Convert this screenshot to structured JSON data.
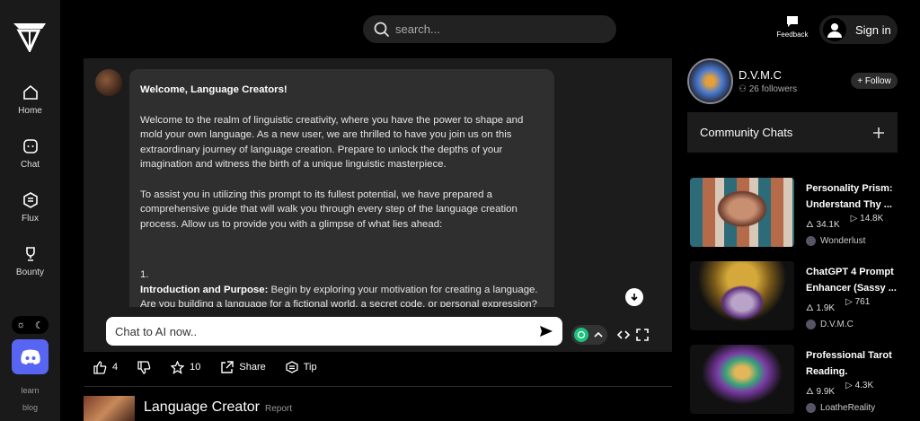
{
  "sidebar": {
    "items": [
      {
        "label": "Home",
        "icon": "home-icon"
      },
      {
        "label": "Chat",
        "icon": "chat-icon"
      },
      {
        "label": "Flux",
        "icon": "flux-icon"
      },
      {
        "label": "Bounty",
        "icon": "trophy-icon"
      }
    ],
    "learn": "learn",
    "blog": "blog"
  },
  "topbar": {
    "search_placeholder": "search...",
    "feedback_label": "Feedback",
    "signin_label": "Sign in"
  },
  "chat": {
    "heading": "Welcome, Language Creators!",
    "para1": "Welcome to the realm of linguistic creativity, where you have the power to shape and mold your own language. As a new user, we are thrilled to have you join us on this extraordinary journey of language creation. Prepare to unlock the depths of your imagination and witness the birth of a unique linguistic masterpiece.",
    "para2": "To assist you in utilizing this prompt to its fullest potential, we have prepared a comprehensive guide that will walk you through every step of the language creation process. Allow us to provide you with a glimpse of what lies ahead:",
    "list_number": "1.",
    "intro_bold": "Introduction and Purpose:",
    "intro_text": " Begin by exploring your motivation for creating a language. Are you building a language for a fictional world, a secret code, or personal expression?",
    "input_placeholder": "Chat to AI now.."
  },
  "actions": {
    "likes": "4",
    "favorites": "10",
    "share": "Share",
    "tip": "Tip"
  },
  "next_prompt": {
    "title": "Language Creator",
    "report": "Report"
  },
  "creator": {
    "name": "D.V.M.C",
    "followers": "26 followers",
    "follow_label": "+ Follow"
  },
  "community": {
    "title": "Community Chats"
  },
  "cards": [
    {
      "title": "Personality Prism: Understand Thy ...",
      "views": "34.1K",
      "plays": "14.8K",
      "author": "Wonderlust"
    },
    {
      "title": "ChatGPT 4 Prompt Enhancer (Sassy ...",
      "views": "1.9K",
      "plays": "761",
      "author": "D.V.M.C"
    },
    {
      "title": "Professional Tarot Reading.",
      "views": "9.9K",
      "plays": "4.3K",
      "author": "LoatheReality"
    }
  ],
  "colors": {
    "discord": "#5865f2",
    "panel": "#1c1c1c",
    "bubble": "#2f2f2f",
    "gpt": "#19c37d"
  }
}
